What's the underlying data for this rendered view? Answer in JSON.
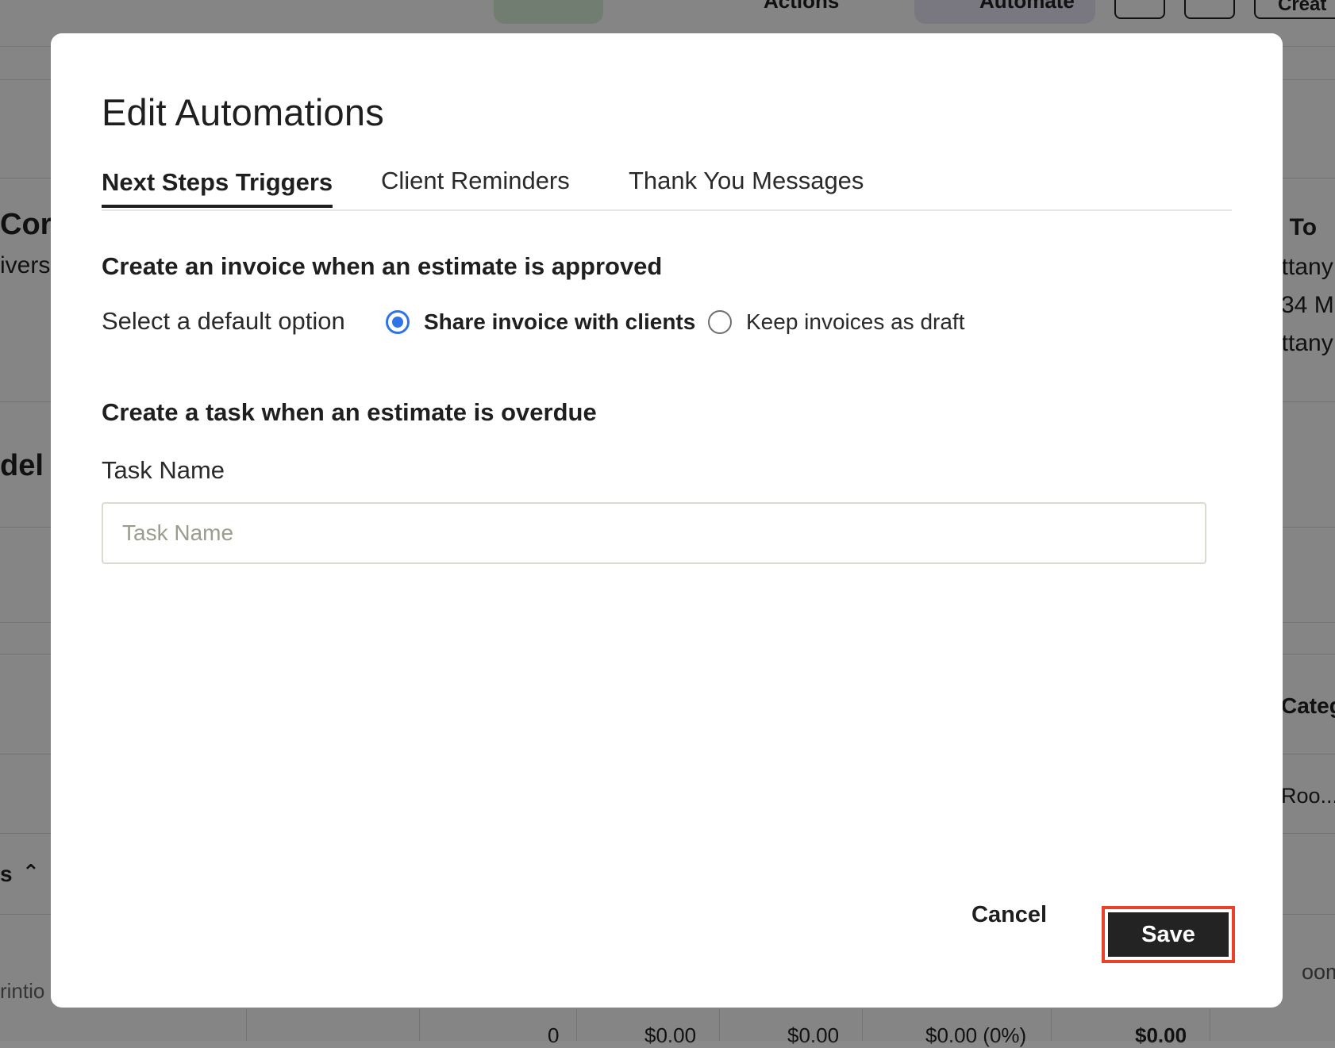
{
  "background": {
    "fragments": {
      "left_title": "Cor",
      "left_sub": "ivers",
      "left_heading": "del",
      "left_section": "s",
      "left_bottom": "rintio",
      "right_title": "l To",
      "right_line1": "ittany",
      "right_line2": "34 M",
      "right_line3": "ittany",
      "right_header": "Categ",
      "right_cell": "Roo...",
      "right_cell2": "oom",
      "top_actions": "Actions",
      "top_automate": "Automate",
      "top_create": "Creat"
    },
    "bottom_row": [
      "0",
      "$0.00",
      "$0.00",
      "$0.00 (0%)",
      "$0.00"
    ]
  },
  "modal": {
    "title": "Edit Automations",
    "tabs": [
      {
        "label": "Next Steps Triggers",
        "active": true
      },
      {
        "label": "Client Reminders",
        "active": false
      },
      {
        "label": "Thank You Messages",
        "active": false
      }
    ],
    "invoice_section": {
      "title": "Create an invoice when an estimate is approved",
      "option_label": "Select a default option",
      "options": [
        {
          "label": "Share invoice with clients",
          "selected": true
        },
        {
          "label": "Keep invoices as draft",
          "selected": false
        }
      ]
    },
    "task_section": {
      "title": "Create a task when an estimate is overdue",
      "field_label": "Task Name",
      "field_value": "",
      "field_placeholder": "Task Name"
    },
    "footer": {
      "cancel_label": "Cancel",
      "save_label": "Save"
    }
  },
  "colors": {
    "accent": "#2f73e8",
    "primary_button": "#232323",
    "highlight": "#e8432a"
  }
}
